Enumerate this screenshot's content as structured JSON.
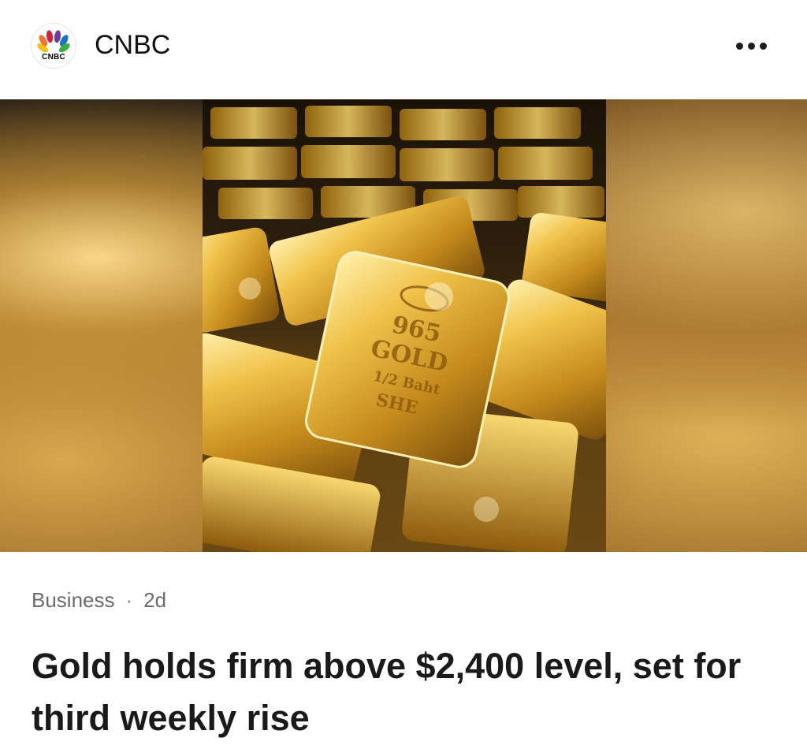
{
  "source": {
    "name": "CNBC",
    "logo_text": "CNBC",
    "logo_icon": "peacock-icon",
    "peacock_colors": [
      "#f2c21b",
      "#e8783a",
      "#d1203f",
      "#6a3d9a",
      "#1a74c2",
      "#3cae47"
    ]
  },
  "menu": {
    "icon": "more-horizontal-icon"
  },
  "hero": {
    "subject": "gold bars",
    "accent": "#d4a02e"
  },
  "article": {
    "category": "Business",
    "separator": "·",
    "age": "2d",
    "headline": "Gold holds firm above $2,400 level, set for third weekly rise"
  }
}
